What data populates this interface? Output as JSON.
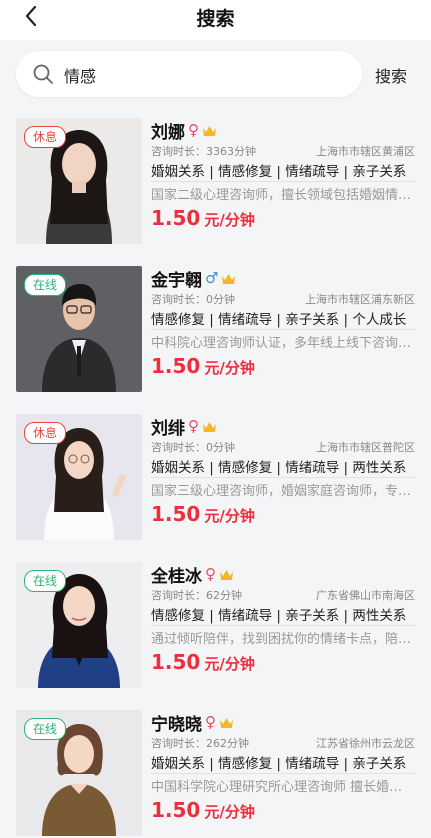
{
  "header": {
    "title": "搜索"
  },
  "search": {
    "value": "情感",
    "button": "搜索"
  },
  "colors": {
    "price": "#ee2e3d",
    "busy": "#e6463a",
    "online": "#2bb673"
  },
  "counselors": [
    {
      "status": "休息",
      "name": "刘娜",
      "gender": "female",
      "duration": "咨询时长：3363分钟",
      "location": "上海市市辖区黄浦区",
      "tags": "婚姻关系 | 情感修复 | 情绪疏导 | 亲子关系",
      "intro": "国家二级心理咨询师，擅长领域包括婚姻情感、情绪管理等",
      "price": "1.50",
      "unit": "元/分钟"
    },
    {
      "status": "在线",
      "name": "金宇翱",
      "gender": "male",
      "duration": "咨询时长：0分钟",
      "location": "上海市市辖区浦东新区",
      "tags": "情感修复 | 情绪疏导 | 亲子关系 | 个人成长",
      "intro": "中科院心理咨询师认证，多年线上线下咨询经验",
      "price": "1.50",
      "unit": "元/分钟"
    },
    {
      "status": "休息",
      "name": "刘绯",
      "gender": "female",
      "duration": "咨询时长：0分钟",
      "location": "上海市市辖区普陀区",
      "tags": "婚姻关系 | 情感修复 | 情绪疏导 | 两性关系",
      "intro": "国家三级心理咨询师，婚姻家庭咨询师，专注情感咨询",
      "price": "1.50",
      "unit": "元/分钟"
    },
    {
      "status": "在线",
      "name": "全桂冰",
      "gender": "female",
      "duration": "咨询时长：62分钟",
      "location": "广东省佛山市南海区",
      "tags": "情感修复 | 情绪疏导 | 亲子关系 | 两性关系",
      "intro": "通过倾听陪伴，找到困扰你的情绪卡点，陪你走出困境",
      "price": "1.50",
      "unit": "元/分钟"
    },
    {
      "status": "在线",
      "name": "宁晓晓",
      "gender": "female",
      "duration": "咨询时长：262分钟",
      "location": "江苏省徐州市云龙区",
      "tags": "婚姻关系 | 情感修复 | 情绪疏导 | 亲子关系",
      "intro": "中国科学院心理研究所心理咨询师 擅长婚恋情感",
      "price": "1.50",
      "unit": "元/分钟"
    }
  ]
}
